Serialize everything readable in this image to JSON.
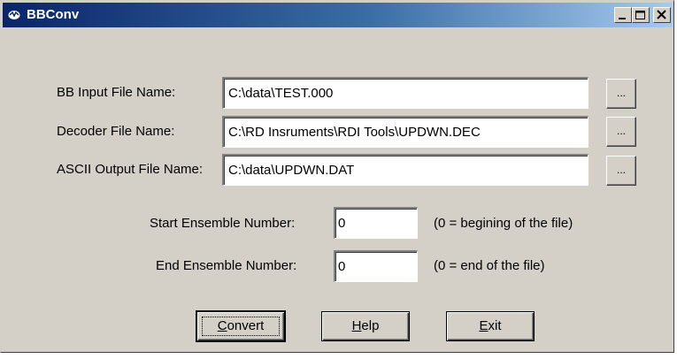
{
  "window": {
    "title": "BBConv"
  },
  "files": {
    "input_label": "BB Input File Name:",
    "input_value": "C:\\data\\TEST.000",
    "decoder_label": "Decoder File Name:",
    "decoder_value": "C:\\RD Insruments\\RDI Tools\\UPDWN.DEC",
    "output_label": "ASCII Output File Name:",
    "output_value": "C:\\data\\UPDWN.DAT",
    "browse_label": "..."
  },
  "ensembles": {
    "start_label": "Start Ensemble Number:",
    "start_value": "0",
    "start_hint": "(0 = begining of the file)",
    "end_label": "End Ensemble Number:",
    "end_value": "0",
    "end_hint": "(0 = end of the file)"
  },
  "buttons": {
    "convert_first": "C",
    "convert_rest": "onvert",
    "help_first": "H",
    "help_rest": "elp",
    "exit_first": "E",
    "exit_rest": "xit"
  },
  "icons": {
    "app": "app-icon",
    "minimize": "minimize-icon",
    "maximize": "maximize-icon",
    "close": "close-icon"
  }
}
